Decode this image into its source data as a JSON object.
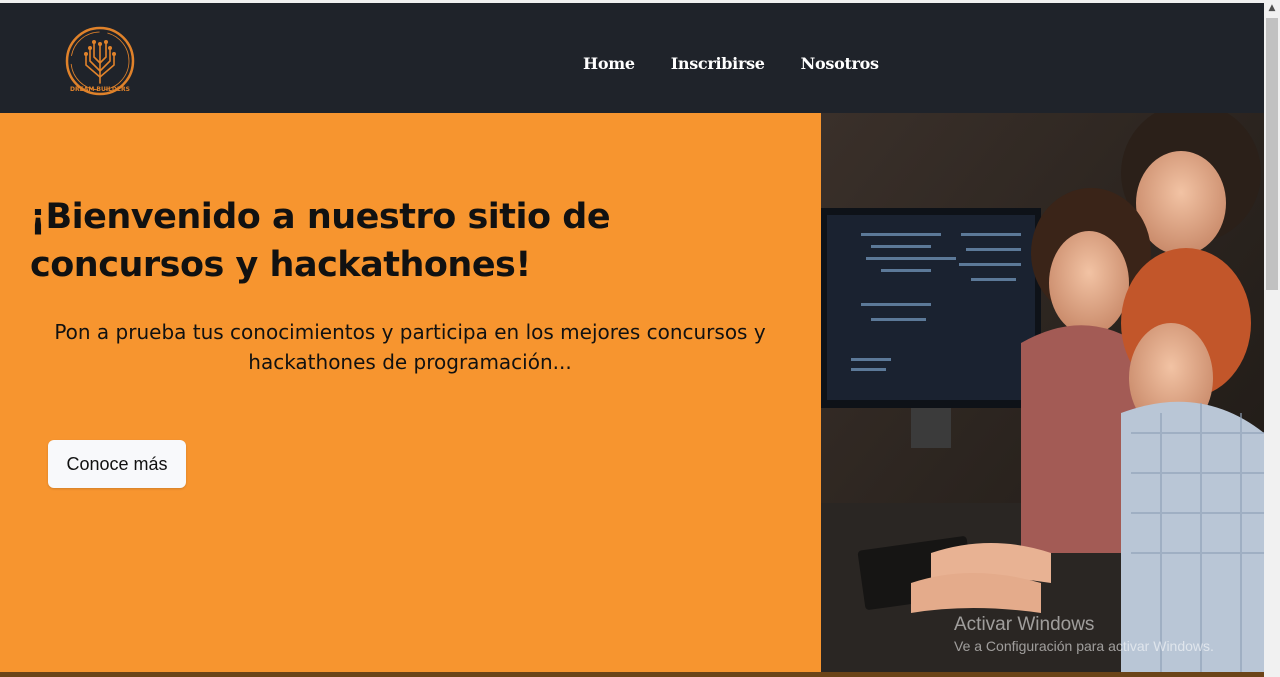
{
  "nav": {
    "logo_text": "DREAM BUILDERS",
    "links": [
      "Home",
      "Inscribirse",
      "Nosotros"
    ]
  },
  "hero": {
    "title": "¡Bienvenido a nuestro sitio de concursos y hackathones!",
    "subtitle": "Pon a prueba tus conocimientos y participa en los mejores concursos y hackathones de programación...",
    "cta_label": "Conoce más",
    "image_description_icon": "team-coding-photo"
  },
  "watermark": {
    "title": "Activar Windows",
    "subtitle": "Ve a Configuración para activar Windows."
  },
  "colors": {
    "navbar": "#1f232a",
    "hero_accent": "#f7952f",
    "logo_orange": "#e0822a"
  }
}
